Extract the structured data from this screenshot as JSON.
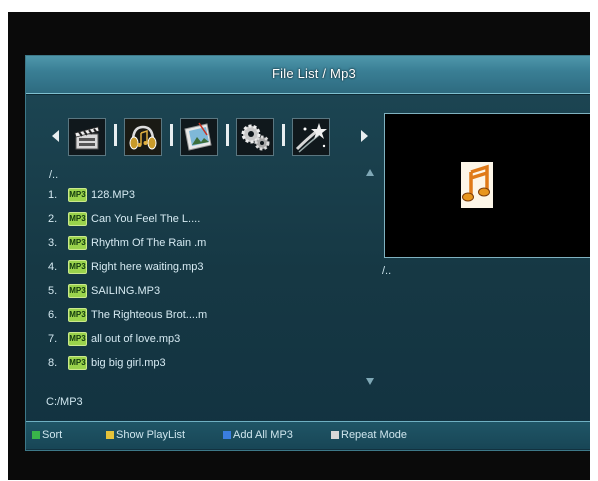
{
  "window": {
    "title": "File List / Mp3"
  },
  "categories": [
    {
      "icon": "movie-clapper-icon"
    },
    {
      "icon": "music-headphones-icon"
    },
    {
      "icon": "photo-picture-icon"
    },
    {
      "icon": "settings-gears-icon"
    },
    {
      "icon": "star-effects-icon"
    }
  ],
  "list": {
    "up_dir": "/..",
    "badge": "MP3",
    "items": [
      {
        "num": "1.",
        "name": "128.MP3"
      },
      {
        "num": "2.",
        "name": "Can You Feel The L...."
      },
      {
        "num": "3.",
        "name": "Rhythm Of The Rain .m"
      },
      {
        "num": "4.",
        "name": "Right here waiting.mp3"
      },
      {
        "num": "5.",
        "name": "SAILING.MP3"
      },
      {
        "num": "6.",
        "name": "The Righteous Brot....m"
      },
      {
        "num": "7.",
        "name": "all out of love.mp3"
      },
      {
        "num": "8.",
        "name": "big big girl.mp3"
      }
    ],
    "current_path": "C:/MP3"
  },
  "preview": {
    "icon": "music-note-icon",
    "path": "/.."
  },
  "footer": {
    "keys": [
      {
        "label": "Sort",
        "color": "#39b54a"
      },
      {
        "label": "Show PlayList",
        "color": "#e5c33a"
      },
      {
        "label": "Add All MP3",
        "color": "#3a7ee0"
      },
      {
        "label": "Repeat Mode",
        "color": "#d8d8d8"
      }
    ]
  }
}
